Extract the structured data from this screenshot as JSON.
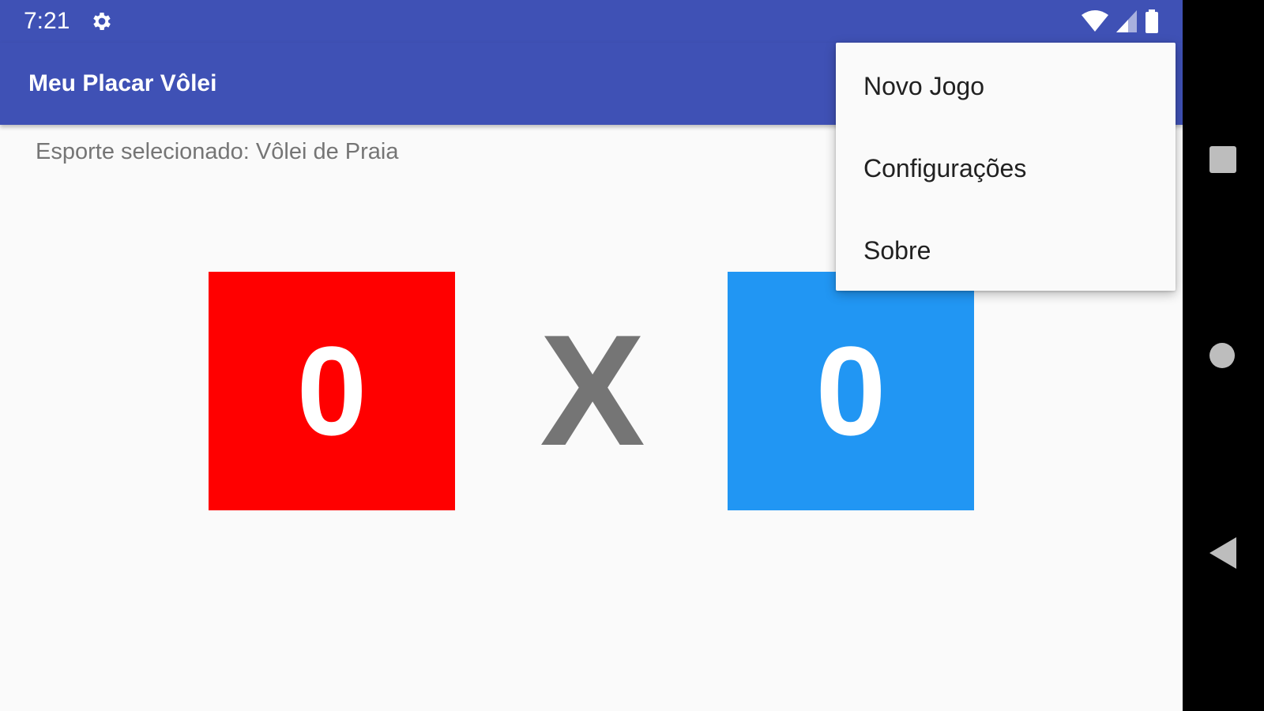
{
  "status_bar": {
    "time": "7:21",
    "icons": [
      "gear-icon",
      "wifi-icon",
      "cell-signal-icon",
      "battery-icon"
    ]
  },
  "app_bar": {
    "title": "Meu Placar Vôlei"
  },
  "main": {
    "sport_label": "Esporte selecionado: Vôlei de Praia",
    "score_left": "0",
    "versus": "X",
    "score_right": "0",
    "colors": {
      "primary": "#3f51b5",
      "left_team": "#ff0000",
      "right_team": "#2196f3",
      "versus": "#757575"
    }
  },
  "menu": {
    "items": [
      {
        "label": "Novo Jogo"
      },
      {
        "label": "Configurações"
      },
      {
        "label": "Sobre"
      }
    ]
  },
  "nav_bar": {
    "icons": [
      "recents-square-icon",
      "home-circle-icon",
      "back-triangle-icon"
    ]
  }
}
